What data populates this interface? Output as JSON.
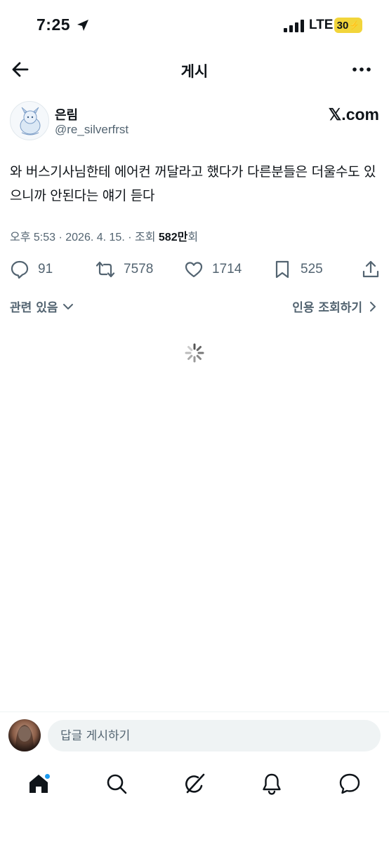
{
  "status_bar": {
    "time": "7:25",
    "network": "LTE",
    "battery": "30"
  },
  "header": {
    "title": "게시"
  },
  "post": {
    "author_name": "은림",
    "author_handle": "@re_silverfrst",
    "source": "𝕏.com",
    "text": "와 버스기사님한테 에어컨 꺼달라고 했다가 다른분들은 더울수도 있으니까 안된다는 얘기 듣다",
    "time": "오후 5:53",
    "date": "2026. 4. 15.",
    "views_label": "조회",
    "views_count": "582만",
    "views_suffix": "회"
  },
  "actions": {
    "replies": "91",
    "reposts": "7578",
    "likes": "1714",
    "bookmarks": "525"
  },
  "related": {
    "left_label": "관련 있음",
    "right_label": "인용 조회하기"
  },
  "reply": {
    "placeholder": "답글 게시하기"
  },
  "tabs": [
    "home",
    "search",
    "grok",
    "notifications",
    "messages"
  ],
  "colors": {
    "accent": "#1d9bf0",
    "muted": "#536471",
    "text": "#0f1419",
    "battery": "#f2d53b"
  }
}
